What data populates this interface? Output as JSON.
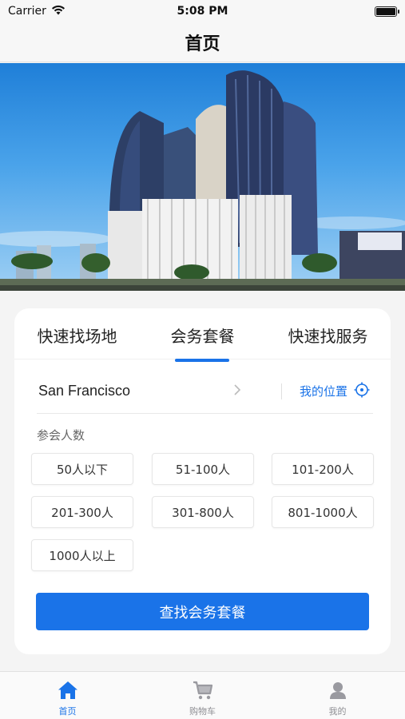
{
  "status_bar": {
    "carrier": "Carrier",
    "time": "5:08 PM"
  },
  "nav": {
    "title": "首页"
  },
  "banner": {
    "image": "hotel-building-photo"
  },
  "tabs": [
    {
      "label": "快速找场地",
      "active": false
    },
    {
      "label": "会务套餐",
      "active": true
    },
    {
      "label": "快速找服务",
      "active": false
    }
  ],
  "location": {
    "city": "San Francisco",
    "my_location_label": "我的位置"
  },
  "attendees": {
    "label": "参会人数",
    "options": [
      "50人以下",
      "51-100人",
      "101-200人",
      "201-300人",
      "301-800人",
      "801-1000人",
      "1000人以上"
    ]
  },
  "search_button_label": "查找会务套餐",
  "tab_bar": [
    {
      "label": "首页",
      "icon": "home-icon",
      "active": true
    },
    {
      "label": "购物车",
      "icon": "cart-icon",
      "active": false
    },
    {
      "label": "我的",
      "icon": "user-icon",
      "active": false
    }
  ],
  "colors": {
    "accent": "#1a73e8",
    "inactive": "#8e8e93"
  }
}
